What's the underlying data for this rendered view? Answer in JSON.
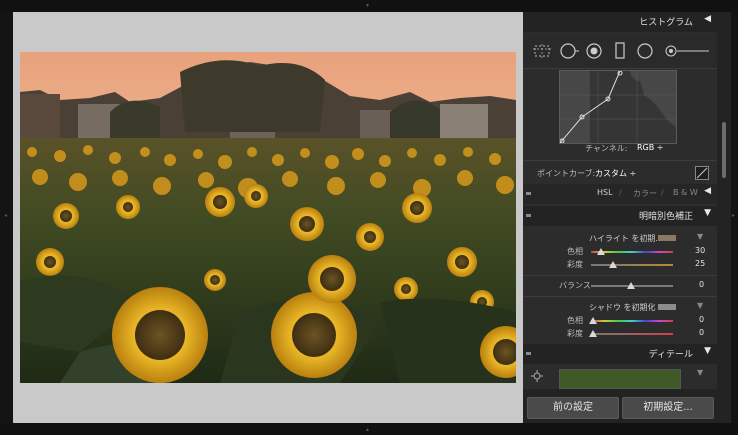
{
  "panel": {
    "histogram_title": "ヒストグラム",
    "tone_curve": {
      "channel_label": "チャンネル:",
      "channel_value": "RGB",
      "point_curve_label": "ポイントカーブ:",
      "point_curve_value": "カスタム"
    },
    "tabs": {
      "hsl": "HSL",
      "sep1": "/",
      "color": "カラー",
      "sep2": "/",
      "bw": "B & W"
    },
    "split_toning": {
      "title": "明暗別色補正",
      "highlights_label": "ハイライト を初期...",
      "highlight_hue_label": "色相",
      "highlight_hue_value": "30",
      "highlight_saturation_label": "彩度",
      "highlight_saturation_value": "25",
      "balance_label": "バランス",
      "balance_value": "0",
      "shadows_label": "シャドウ を初期化",
      "shadow_hue_label": "色相",
      "shadow_hue_value": "0",
      "shadow_saturation_label": "彩度",
      "shadow_saturation_value": "0",
      "highlight_swatch_color": "#8a7a63",
      "shadow_swatch_color": "#8c8c8c"
    },
    "detail_title": "ディテール",
    "buttons": {
      "previous": "前の設定",
      "reset": "初期設定..."
    }
  },
  "icons": {
    "collapse": "triangle-left-icon",
    "expand": "triangle-down-icon",
    "tools": [
      "crop-overlay-icon",
      "spot-removal-icon",
      "red-eye-icon",
      "graduated-filter-icon",
      "radial-filter-icon",
      "adjustment-brush-icon"
    ]
  }
}
